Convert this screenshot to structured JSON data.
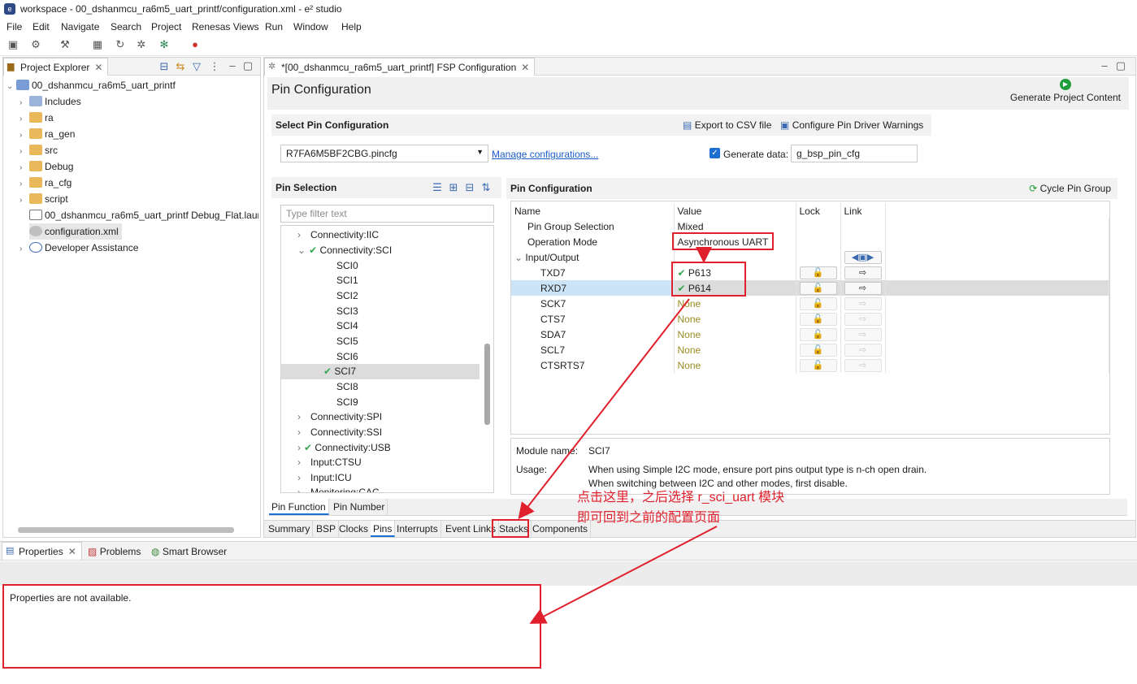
{
  "window": {
    "title": "workspace - 00_dshanmcu_ra6m5_uart_printf/configuration.xml - e² studio"
  },
  "menu": [
    "File",
    "Edit",
    "Navigate",
    "Search",
    "Project",
    "Renesas Views",
    "Run",
    "Window",
    "Help"
  ],
  "project_explorer": {
    "tab": "Project Explorer",
    "root": "00_dshanmcu_ra6m5_uart_printf",
    "items": [
      "Includes",
      "ra",
      "ra_gen",
      "src",
      "Debug",
      "ra_cfg",
      "script",
      "00_dshanmcu_ra6m5_uart_printf Debug_Flat.launc",
      "configuration.xml",
      "Developer Assistance"
    ]
  },
  "editor": {
    "tab": "*[00_dshanmcu_ra6m5_uart_printf] FSP Configuration",
    "heading": "Pin Configuration",
    "generate": "Generate Project Content",
    "select_section": "Select Pin Configuration",
    "export": "Export to CSV file",
    "warnings": "Configure Pin Driver Warnings",
    "pincfg_file": "R7FA6M5BF2CBG.pincfg",
    "manage": "Manage configurations...",
    "generate_data_label": "Generate data:",
    "generate_data_value": "g_bsp_pin_cfg",
    "pin_selection": {
      "title": "Pin Selection",
      "filter_placeholder": "Type filter text",
      "rows": [
        "Connectivity:IIC",
        "Connectivity:SCI",
        "SCI0",
        "SCI1",
        "SCI2",
        "SCI3",
        "SCI4",
        "SCI5",
        "SCI6",
        "SCI7",
        "SCI8",
        "SCI9",
        "Connectivity:SPI",
        "Connectivity:SSI",
        "Connectivity:USB",
        "Input:CTSU",
        "Input:ICU",
        "Monitoring:CAC"
      ]
    },
    "pin_config": {
      "title": "Pin Configuration",
      "cycle": "Cycle Pin Group",
      "headers": [
        "Name",
        "Value",
        "Lock",
        "Link"
      ],
      "rows": [
        {
          "name": "Pin Group Selection",
          "value": "Mixed"
        },
        {
          "name": "Operation Mode",
          "value": "Asynchronous UART"
        },
        {
          "name": "Input/Output",
          "value": ""
        },
        {
          "name": "TXD7",
          "value": "P613"
        },
        {
          "name": "RXD7",
          "value": "P614"
        },
        {
          "name": "SCK7",
          "value": "None"
        },
        {
          "name": "CTS7",
          "value": "None"
        },
        {
          "name": "SDA7",
          "value": "None"
        },
        {
          "name": "SCL7",
          "value": "None"
        },
        {
          "name": "CTSRTS7",
          "value": "None"
        }
      ],
      "module_name_label": "Module name:",
      "module_name": "SCI7",
      "usage_label": "Usage:",
      "usage_1": "When using Simple I2C mode, ensure port pins output type is n-ch open drain.",
      "usage_2": "When switching between I2C and other modes, first disable."
    },
    "pin_tabs": [
      "Pin Function",
      "Pin Number"
    ],
    "bottom_tabs": [
      "Summary",
      "BSP",
      "Clocks",
      "Pins",
      "Interrupts",
      "Event Links",
      "Stacks",
      "Components"
    ]
  },
  "bottom": {
    "tabs": [
      "Properties",
      "Problems",
      "Smart Browser"
    ],
    "message": "Properties are not available."
  },
  "annotation": {
    "line1": "点击这里，之后选择 r_sci_uart 模块",
    "line2": "即可回到之前的配置页面"
  },
  "colors": {
    "accent": "#e0202c",
    "selection": "#cce4f7",
    "check": "#34a853"
  }
}
